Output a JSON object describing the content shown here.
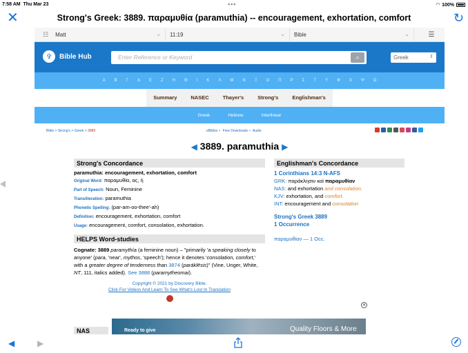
{
  "status": {
    "time": "7:58 AM",
    "day": "Thu Mar 23",
    "battery": "100%"
  },
  "modal": {
    "title": "Strong's Greek: 3889. παραμυθία (paramuthia) -- encouragement, exhortation, comfort"
  },
  "selects": {
    "book": "Matt",
    "chapter": "11:19",
    "version": "Bible"
  },
  "header": {
    "logo_text": "Bible Hub",
    "search_placeholder": "Enter Reference or Keyword",
    "language": "Greek"
  },
  "alphabet": [
    "Α",
    "Β",
    "Γ",
    "Δ",
    "Ε",
    "Ζ",
    "Η",
    "Θ",
    "Ι",
    "Κ",
    "Λ",
    "Μ",
    "Ν",
    "Ξ",
    "Ο",
    "Π",
    "Ρ",
    "Σ",
    "Τ",
    "Υ",
    "Φ",
    "Χ",
    "Ψ",
    "Ω"
  ],
  "tabs": [
    "Summary",
    "NASEC",
    "Thayer's",
    "Strong's",
    "Englishman's"
  ],
  "subtabs": [
    "Greek",
    "Hebrew",
    "Interlinear"
  ],
  "breadcrumb": {
    "bible": "Bible",
    "strongs": "Strong's",
    "greek": "Greek",
    "current": "3889"
  },
  "midlinks": [
    "eBibles",
    "Free Downloads",
    "Audio"
  ],
  "word": {
    "title": "3889. paramuthia"
  },
  "concordance": {
    "heading": "Strong's Concordance",
    "entry": "paramuthia: encouragement, exhortation, comfort",
    "original_word_label": "Original Word:",
    "original_word": "παραμυθία, ας, ἡ",
    "pos_label": "Part of Speech:",
    "pos": "Noun, Feminine",
    "translit_label": "Transliteration:",
    "translit": "paramuthia",
    "phonetic_label": "Phonetic Spelling:",
    "phonetic": "(par-am-oo-thee'-ah)",
    "definition_label": "Definition:",
    "definition": "encouragement, exhortation, comfort",
    "usage_label": "Usage:",
    "usage": "encouragement, comfort, consolation, exhortation."
  },
  "helps": {
    "heading": "HELPS Word-studies",
    "p_bold": "Cognate: 3889",
    "p1": "paramythía",
    "p2": " (a feminine noun) – \"primarily 'a ",
    "p3": "speaking closely",
    "p4": " to anyone' (",
    "p5": "para",
    "p6": ", 'near', ",
    "p7": "mythos",
    "p8": ", 'speech'); hence it denotes '",
    "p9": "consolation, comfort",
    "p10": ",' with a ",
    "p11": "greater degree of tenderness",
    "p12": " than ",
    "p13": "3874",
    "p14": " (",
    "p15": "paráklēsis",
    "p16": ")\" (Vine, Unger, White, ",
    "p17": "NT",
    "p18": ", 111, italics added). ",
    "p19": "See 3888",
    "p20": " (",
    "p21": "paramytheomai",
    "p22": ")."
  },
  "copyright": {
    "line1": "Copyright © 2021 by Discovery Bible.",
    "line2": "Click For Videos And Learn To See What's Lost In Translation"
  },
  "englishman": {
    "heading": "Englishman's Concordance",
    "ref": "1 Corinthians 14:3 N-AFS",
    "grk_label": "GRK:",
    "grk_a": " παράκλησιν καὶ ",
    "grk_b": "παραμυθίαν",
    "nas_label": "NAS:",
    "nas_a": " and exhortation ",
    "nas_b": "and consolation.",
    "kjv_label": "KJV:",
    "kjv_a": " exhortation, and ",
    "kjv_b": "comfort.",
    "int_label": "INT:",
    "int_a": " encouragement and ",
    "int_b": "consolation",
    "strongs_link": "Strong's Greek 3889",
    "occurrence": "1 Occurrence",
    "occ_item": "παραμυθίαν — 1 Occ."
  },
  "ad": {
    "text1": "Ready to give",
    "text2": "Quality Floors & More"
  },
  "nas_cut": "NAS Exha"
}
